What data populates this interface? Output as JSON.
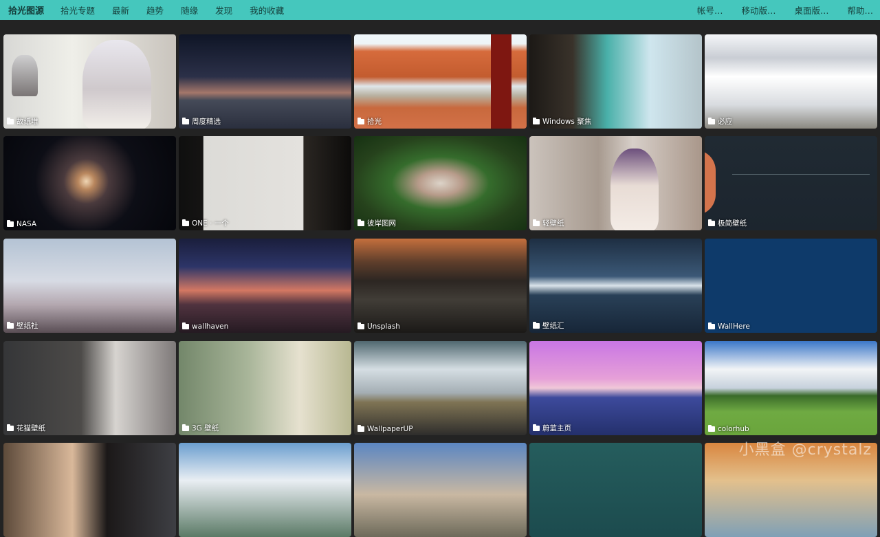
{
  "header": {
    "brand": "拾光图源",
    "nav": [
      "拾光专题",
      "最新",
      "趋势",
      "随缘",
      "发现",
      "我的收藏"
    ],
    "right_nav": [
      "帐号…",
      "移动版…",
      "桌面版…",
      "帮助…"
    ]
  },
  "cards": [
    {
      "label": "故纸堆"
    },
    {
      "label": "周度精选"
    },
    {
      "label": "拾光"
    },
    {
      "label": "Windows 聚焦"
    },
    {
      "label": "必应"
    },
    {
      "label": "NASA"
    },
    {
      "label": "ONE · 一个"
    },
    {
      "label": "彼岸图网"
    },
    {
      "label": "轻壁纸"
    },
    {
      "label": "极简壁纸"
    },
    {
      "label": "壁纸社"
    },
    {
      "label": "wallhaven"
    },
    {
      "label": "Unsplash"
    },
    {
      "label": "壁纸汇"
    },
    {
      "label": "WallHere"
    },
    {
      "label": "花猫壁纸"
    },
    {
      "label": "3G 壁纸"
    },
    {
      "label": "WallpaperUP"
    },
    {
      "label": "蔚蓝主页"
    },
    {
      "label": "colorhub"
    },
    {
      "label": ""
    },
    {
      "label": ""
    },
    {
      "label": ""
    },
    {
      "label": ""
    },
    {
      "label": ""
    }
  ],
  "watermark": "小黑盒 @crystalz",
  "colors": {
    "header_bg": "#45c7bd",
    "page_bg": "#232323"
  }
}
